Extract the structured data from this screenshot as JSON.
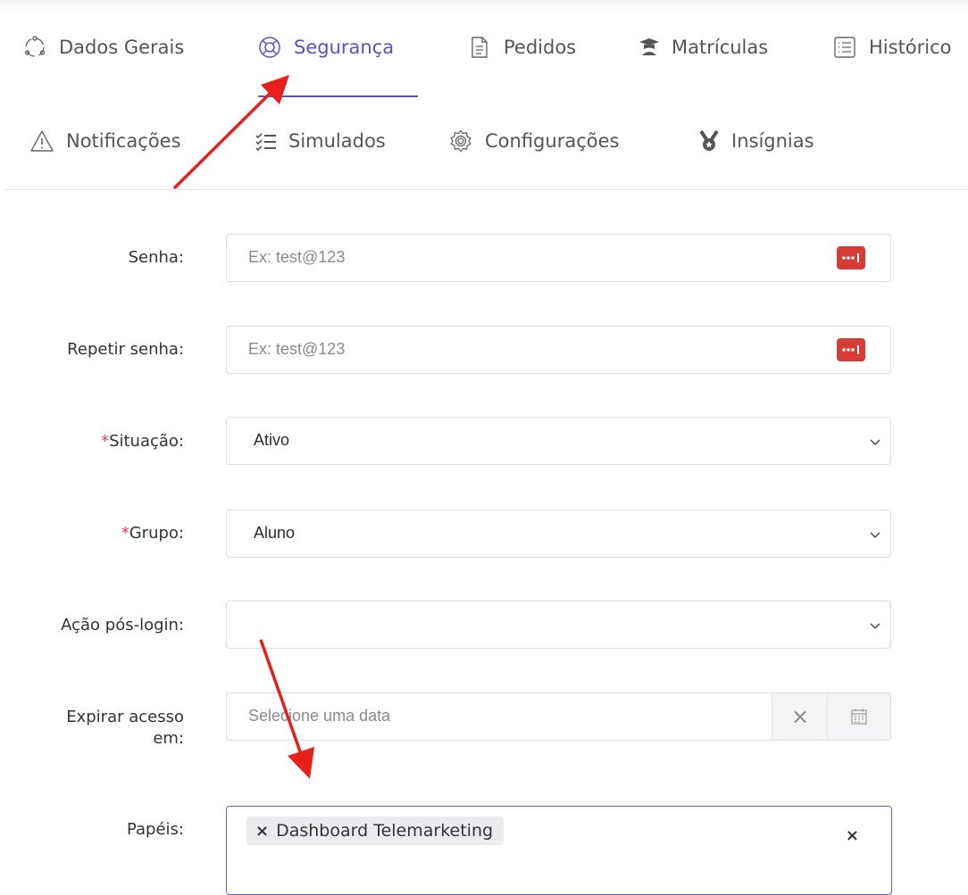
{
  "tabs": [
    {
      "label": "Dados Gerais",
      "icon": "circle-dots-icon",
      "active": false
    },
    {
      "label": "Segurança",
      "icon": "lifebuoy-icon",
      "active": true
    },
    {
      "label": "Pedidos",
      "icon": "document-icon",
      "active": false
    },
    {
      "label": "Matrículas",
      "icon": "graduation-cap-icon",
      "active": false
    },
    {
      "label": "Histórico",
      "icon": "list-icon",
      "active": false
    },
    {
      "label": "Notificações",
      "icon": "warning-icon",
      "active": false
    },
    {
      "label": "Simulados",
      "icon": "checklist-icon",
      "active": false
    },
    {
      "label": "Configurações",
      "icon": "gear-icon",
      "active": false
    },
    {
      "label": "Insígnias",
      "icon": "medal-icon",
      "active": false
    }
  ],
  "form": {
    "senha": {
      "label": "Senha:",
      "placeholder": "Ex: test@123"
    },
    "repetir_senha": {
      "label": "Repetir senha:",
      "placeholder": "Ex: test@123"
    },
    "situacao": {
      "required": "*",
      "label": "Situação:",
      "value": "Ativo"
    },
    "grupo": {
      "required": "*",
      "label": "Grupo:",
      "value": "Aluno"
    },
    "acao_pos_login": {
      "label": "Ação pós-login:",
      "value": ""
    },
    "expirar_acesso": {
      "label_line1": "Expirar acesso",
      "label_line2": "em:",
      "placeholder": "Selecione uma data",
      "clear_symbol": "×"
    },
    "papeis": {
      "label": "Papéis:",
      "chip_remove": "×",
      "chips": [
        "Dashboard Telemarketing"
      ],
      "clear_symbol": "×"
    }
  },
  "colors": {
    "accent": "#5b4fd0",
    "required": "#e0414a",
    "password_button": "#d63c35",
    "annotation_arrow": "#e8201a"
  }
}
